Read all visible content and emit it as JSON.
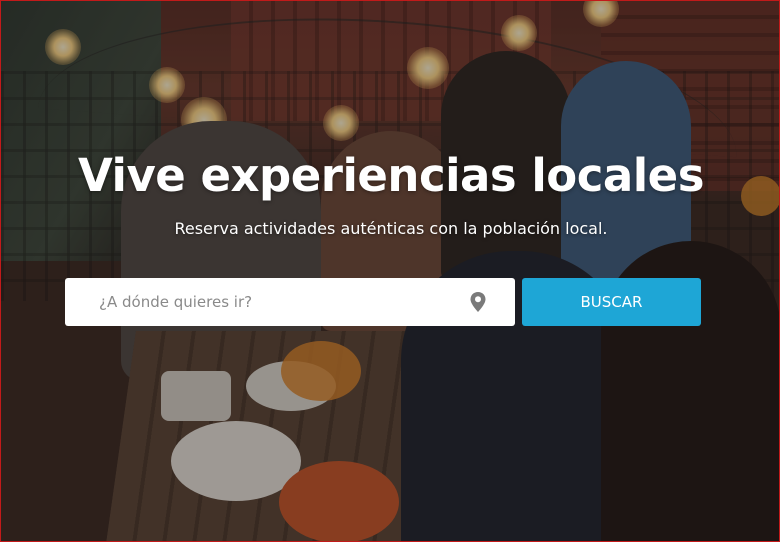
{
  "hero": {
    "title": "Vive experiencias locales",
    "subtitle": "Reserva actividades auténticas con la población local."
  },
  "search": {
    "placeholder": "¿A dónde quieres ir?",
    "value": "",
    "location_icon": "map-pin-icon",
    "button_label": "BUSCAR"
  },
  "colors": {
    "button_background": "#1ea6d6",
    "button_text": "#ffffff",
    "title_text": "#ffffff"
  }
}
